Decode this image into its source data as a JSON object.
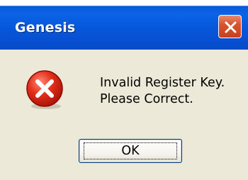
{
  "window": {
    "title": "Genesis",
    "colors": {
      "title_bar": "#0758dc",
      "close_button": "#d8542e",
      "body_background": "#ece9d8"
    }
  },
  "icons": {
    "close": "close-icon",
    "error": "error-icon"
  },
  "message": {
    "line1": "Invalid Register Key.",
    "line2": "Please Correct."
  },
  "buttons": {
    "ok_label": "OK"
  }
}
